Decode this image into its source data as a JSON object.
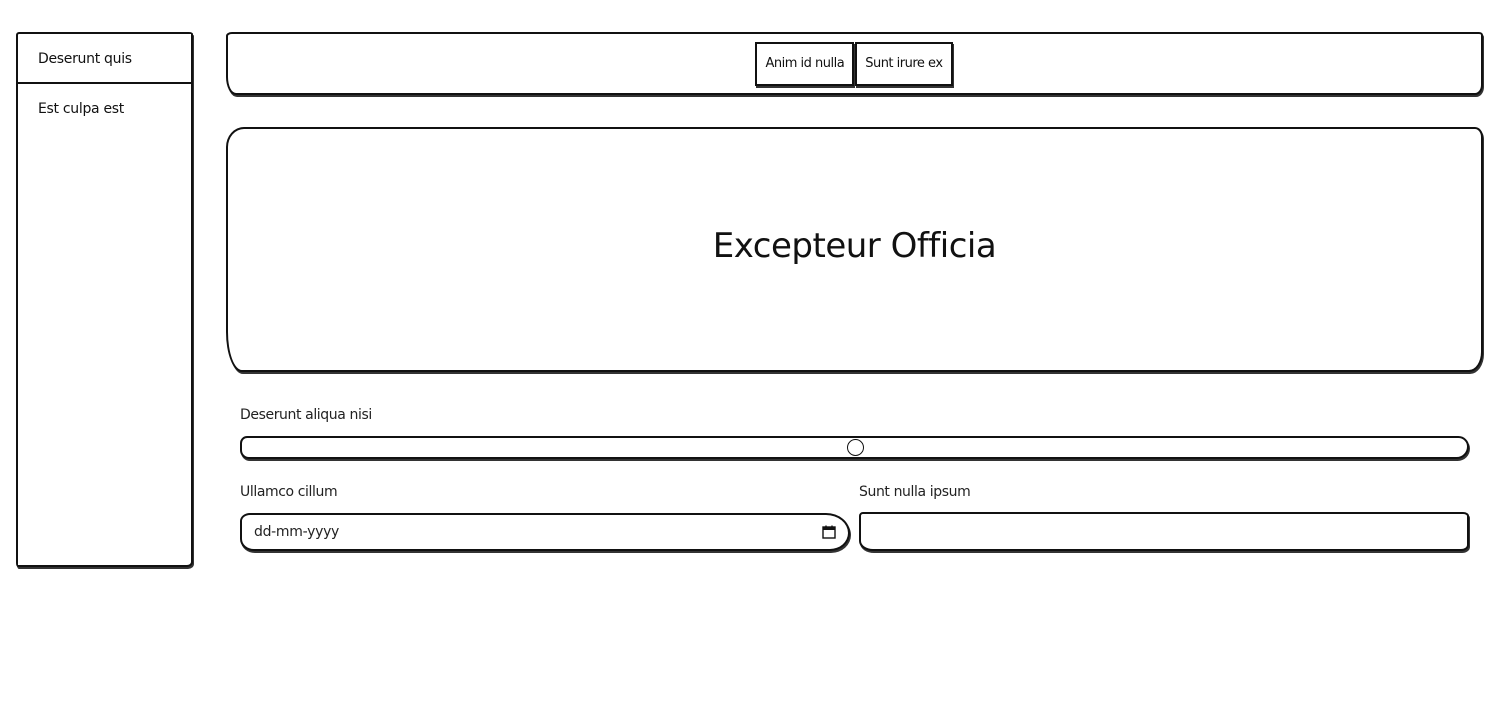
{
  "sidebar": {
    "items": [
      {
        "label": "Deserunt quis"
      },
      {
        "label": "Est culpa est"
      }
    ]
  },
  "header": {
    "buttons": [
      {
        "label": "Anim id nulla"
      },
      {
        "label": "Sunt irure ex"
      }
    ]
  },
  "hero": {
    "title": "Excepteur Officia"
  },
  "form": {
    "slider": {
      "label": "Deserunt aliqua nisi",
      "value": 50,
      "min": 0,
      "max": 100
    },
    "date": {
      "label": "Ullamco cillum",
      "placeholder": "dd-mm-yyyy",
      "icon": "calendar-icon"
    },
    "text": {
      "label": "Sunt nulla ipsum",
      "value": ""
    }
  }
}
